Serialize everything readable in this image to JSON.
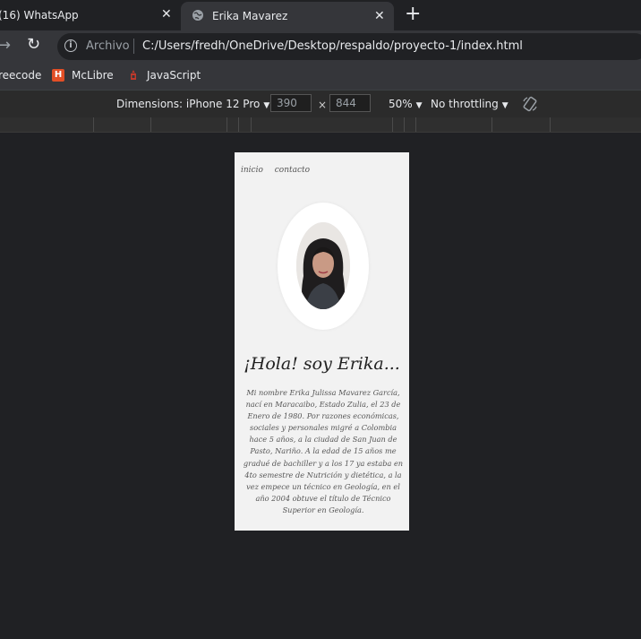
{
  "tabs": [
    {
      "title": "(16) WhatsApp"
    },
    {
      "title": "Erika Mavarez"
    }
  ],
  "address": {
    "security_label": "Archivo",
    "url": "C:/Users/fredh/OneDrive/Desktop/respaldo/proyecto-1/index.html"
  },
  "bookmarks": [
    {
      "label": "reecode"
    },
    {
      "label": "McLibre",
      "icon": "html5-icon"
    },
    {
      "label": "JavaScript",
      "icon": "javascript-icon"
    }
  ],
  "devtools": {
    "dimensions_label": "Dimensions: iPhone 12 Pro",
    "width": "390",
    "height": "844",
    "times": "×",
    "zoom": "50%",
    "throttling": "No throttling"
  },
  "page": {
    "nav": [
      "inicio",
      "contacto"
    ],
    "heading": "¡Hola! soy Erika...",
    "bio": "Mi nombre Erika Julissa Mavarez García, nací en Maracaibo, Estado Zulia, el 23 de Enero de 1980. Por razones económicas, sociales y personales migré a Colombia hace 5 años, a la ciudad de San Juan de Pasto, Nariño. A la edad de 15 años me gradué de bachiller y a los 17 ya estaba en 4to semestre de Nutrición y dietética, a la vez empece un técnico en Geología, en el año 2004 obtuve el título de Técnico Superior en Geología."
  },
  "colors": {
    "browser_bg": "#202124",
    "toolbar_bg": "#35363a",
    "page_bg": "#f2f2f2"
  }
}
